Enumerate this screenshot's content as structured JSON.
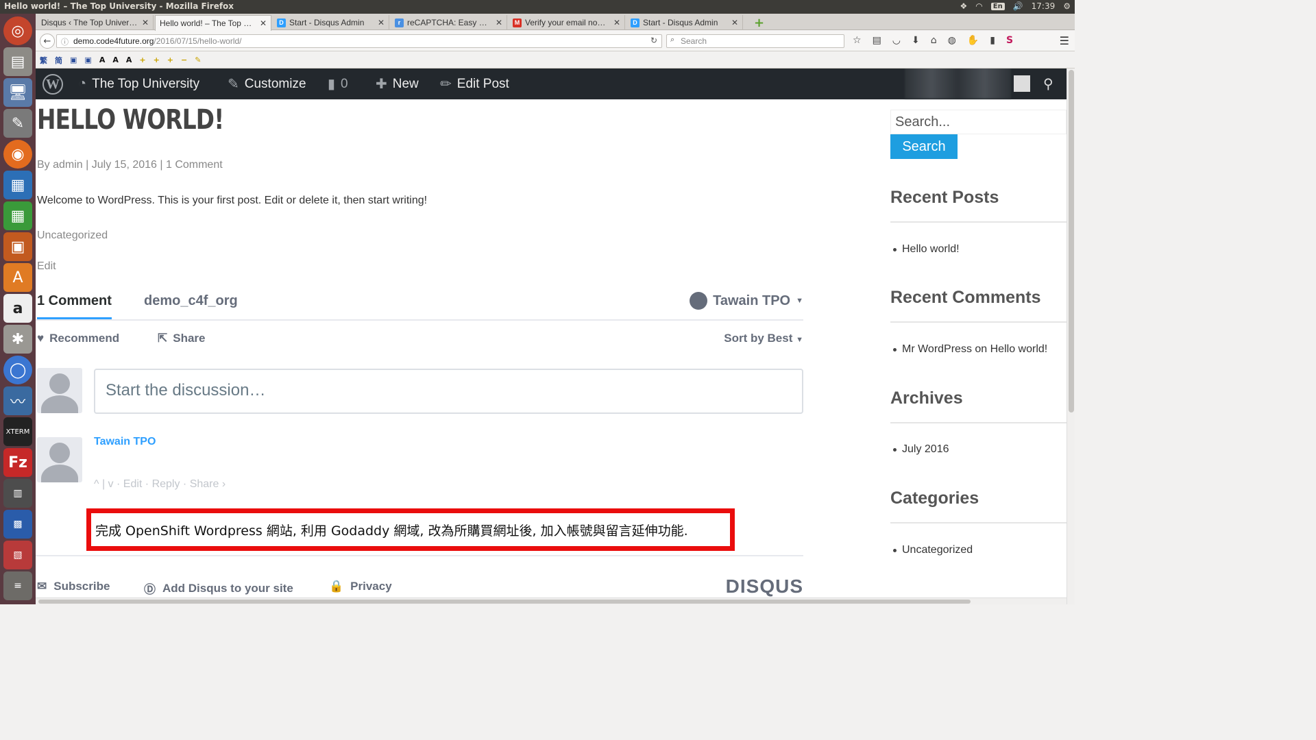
{
  "system_panel": {
    "window_title": "Hello world! – The Top University - Mozilla Firefox",
    "keyboard_layout": "En",
    "clock": "17:39"
  },
  "launcher": {
    "items": [
      "ubuntu-dash",
      "files",
      "remote-desktop",
      "text-editor",
      "firefox",
      "writer",
      "calc",
      "impress",
      "software-center",
      "amazon",
      "system-settings",
      "chromium",
      "system-monitor",
      "xterm",
      "filezilla",
      "app-1",
      "app-2",
      "app-3",
      "workspaces"
    ]
  },
  "tabs": [
    {
      "label": "Disqus ‹ The Top Univer…",
      "favicon": "wp",
      "favcolor": "#21759b",
      "active": false
    },
    {
      "label": "Hello world! – The Top …",
      "favicon": "",
      "favcolor": "",
      "active": true
    },
    {
      "label": "Start - Disqus Admin",
      "favicon": "D",
      "favcolor": "#2e9fff",
      "active": false
    },
    {
      "label": "reCAPTCHA: Easy on…",
      "favicon": "r",
      "favcolor": "#4a90e2",
      "active": false
    },
    {
      "label": "Verify your email no…",
      "favicon": "M",
      "favcolor": "#d93025",
      "active": false
    },
    {
      "label": "Start - Disqus Admin",
      "favicon": "D",
      "favcolor": "#2e9fff",
      "active": false
    }
  ],
  "url": {
    "domain": "demo.code4future.org",
    "path": "/2016/07/15/hello-world/"
  },
  "search_bar": {
    "placeholder": "Search"
  },
  "wp_admin_bar": {
    "site_name": "The Top University",
    "customize": "Customize",
    "comments_count": "0",
    "new": "New",
    "edit_post": "Edit Post"
  },
  "post": {
    "title": "HELLO WORLD!",
    "meta": "By admin | July 15, 2016 | 1 Comment",
    "body": "Welcome to WordPress. This is your first post. Edit or delete it, then start writing!",
    "category": "Uncategorized",
    "edit": "Edit"
  },
  "disqus": {
    "comment_count": "1 Comment",
    "forum": "demo_c4f_org",
    "user": "Tawain TPO",
    "recommend": "Recommend",
    "share": "Share",
    "sort": "Sort by Best",
    "input_placeholder": "Start the discussion…",
    "comment_author": "Tawain TPO",
    "comment_actions": "^ | v · Edit · Reply · Share ›",
    "comment_text": "完成 OpenShift Wordpress 網站, 利用 Godaddy 網域, 改為所購買網址後, 加入帳號與留言延伸功能.",
    "subscribe": "Subscribe",
    "add_disqus": "Add Disqus to your site",
    "privacy": "Privacy",
    "logo": "DISQUS"
  },
  "sidebar": {
    "search_placeholder": "Search...",
    "search_button": "Search",
    "recent_posts_title": "Recent Posts",
    "recent_posts": [
      "Hello world!"
    ],
    "recent_comments_title": "Recent Comments",
    "recent_comments": [
      "Mr WordPress on Hello world!"
    ],
    "archives_title": "Archives",
    "archives": [
      "July 2016"
    ],
    "categories_title": "Categories",
    "categories": [
      "Uncategorized"
    ]
  },
  "colors": {
    "highlight_border": "#ea0d0d",
    "disqus_blue": "#2e9fff",
    "wp_admin_bar": "#23282d",
    "search_button": "#1e9ee0",
    "launcher": "#5a3a41"
  }
}
